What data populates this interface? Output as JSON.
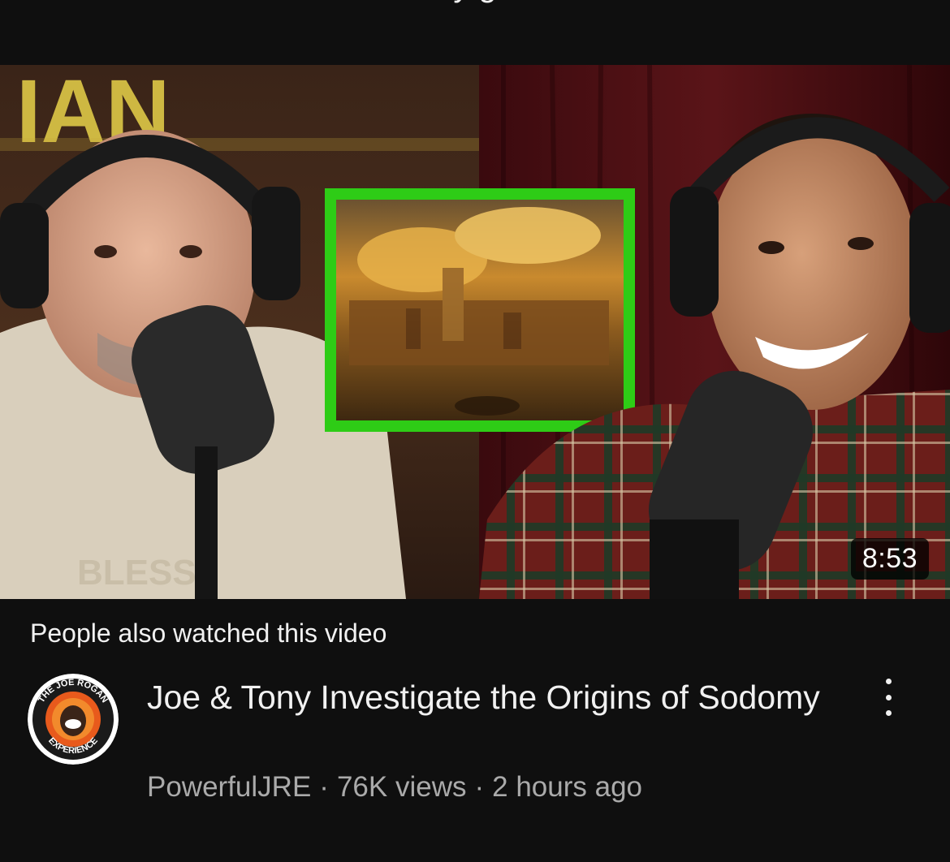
{
  "top_strip": {
    "partial_text": "y  g"
  },
  "thumbnail": {
    "duration": "8:53",
    "accent_frame_color": "#2ecc16",
    "background_text_left": "IAN",
    "shirt_text": "BLESS"
  },
  "section": {
    "label": "People also watched this video"
  },
  "video": {
    "title": "Joe & Tony Investigate the Origins of Sodomy",
    "channel": "PowerfulJRE",
    "separator": "·",
    "views": "76K views",
    "age": "2 hours ago",
    "avatar_text_top": "THE JOE ROGAN",
    "avatar_text_bottom": "EXPERIENCE",
    "more_icon": "vertical-ellipsis-icon"
  }
}
